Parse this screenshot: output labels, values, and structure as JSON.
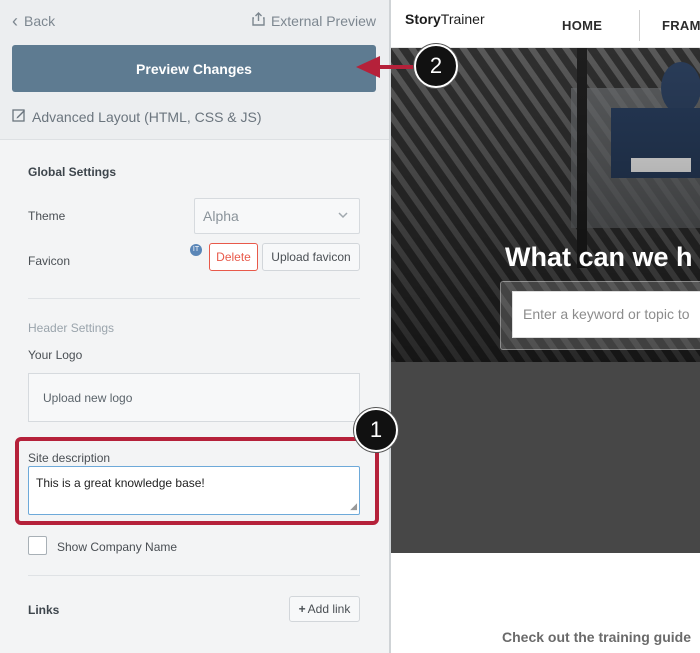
{
  "left": {
    "back_label": "Back",
    "external_preview_label": "External Preview",
    "preview_changes_label": "Preview Changes",
    "advanced_layout_label": "Advanced Layout (HTML, CSS & JS)",
    "global_settings": {
      "title": "Global Settings",
      "theme_label": "Theme",
      "theme_value": "Alpha",
      "favicon_label": "Favicon",
      "delete_label": "Delete",
      "upload_favicon_label": "Upload favicon"
    },
    "header_settings": {
      "title": "Header Settings",
      "your_logo_label": "Your Logo",
      "upload_logo_label": "Upload new logo",
      "site_description_label": "Site description",
      "site_description_value": "This is a great knowledge base!",
      "show_company_name_label": "Show Company Name"
    },
    "links": {
      "label": "Links",
      "add_link_label": "Add link"
    }
  },
  "annotations": {
    "badge_1": "1",
    "badge_2": "2",
    "highlight_color": "#b5213a",
    "arrow_color": "#b5213a"
  },
  "preview": {
    "brand_bold": "Story",
    "brand_light": "Trainer",
    "nav_items": [
      "HOME",
      "FRAM"
    ],
    "hero_title": "What can we h",
    "search_placeholder": "Enter a keyword or topic to",
    "bottom_text": "Check out the training guide"
  },
  "colors": {
    "primary_button": "#5e7b91",
    "delete": "#e8594a",
    "focus_border": "#6da9d9"
  }
}
